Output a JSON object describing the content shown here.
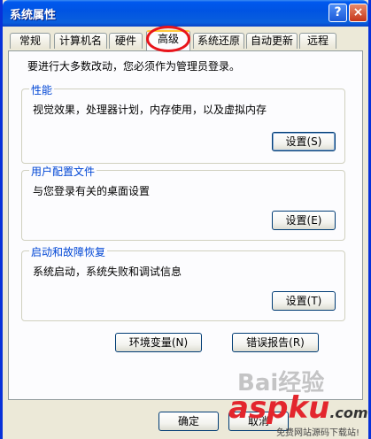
{
  "window": {
    "title": "系统属性",
    "help_label": "?",
    "close_label": "×"
  },
  "tabs": [
    {
      "label": "常规"
    },
    {
      "label": "计算机名"
    },
    {
      "label": "硬件"
    },
    {
      "label": "高级",
      "active": true
    },
    {
      "label": "系统还原"
    },
    {
      "label": "自动更新"
    },
    {
      "label": "远程"
    }
  ],
  "intro": "要进行大多数改动，您必须作为管理员登录。",
  "groups": {
    "performance": {
      "title": "性能",
      "desc": "视觉效果，处理器计划，内存使用，以及虚拟内存",
      "button": "设置(S)"
    },
    "user_profiles": {
      "title": "用户配置文件",
      "desc": "与您登录有关的桌面设置",
      "button": "设置(E)"
    },
    "startup_recovery": {
      "title": "启动和故障恢复",
      "desc": "系统启动，系统失败和调试信息",
      "button": "设置(T)"
    }
  },
  "buttons": {
    "env_vars": "环境变量(N)",
    "error_report": "错误报告(R)"
  },
  "dialog": {
    "ok": "确定",
    "cancel": "取消"
  },
  "watermarks": {
    "baidu": "Bai经验",
    "site": "aspku",
    "site_suffix": ".com",
    "site_sub": "免费网站源码下载站!"
  },
  "colors": {
    "titlebar": "#0054e3",
    "group_title": "#0046d5",
    "highlight_circle": "#e8141b",
    "window_bg": "#ece9d8"
  }
}
